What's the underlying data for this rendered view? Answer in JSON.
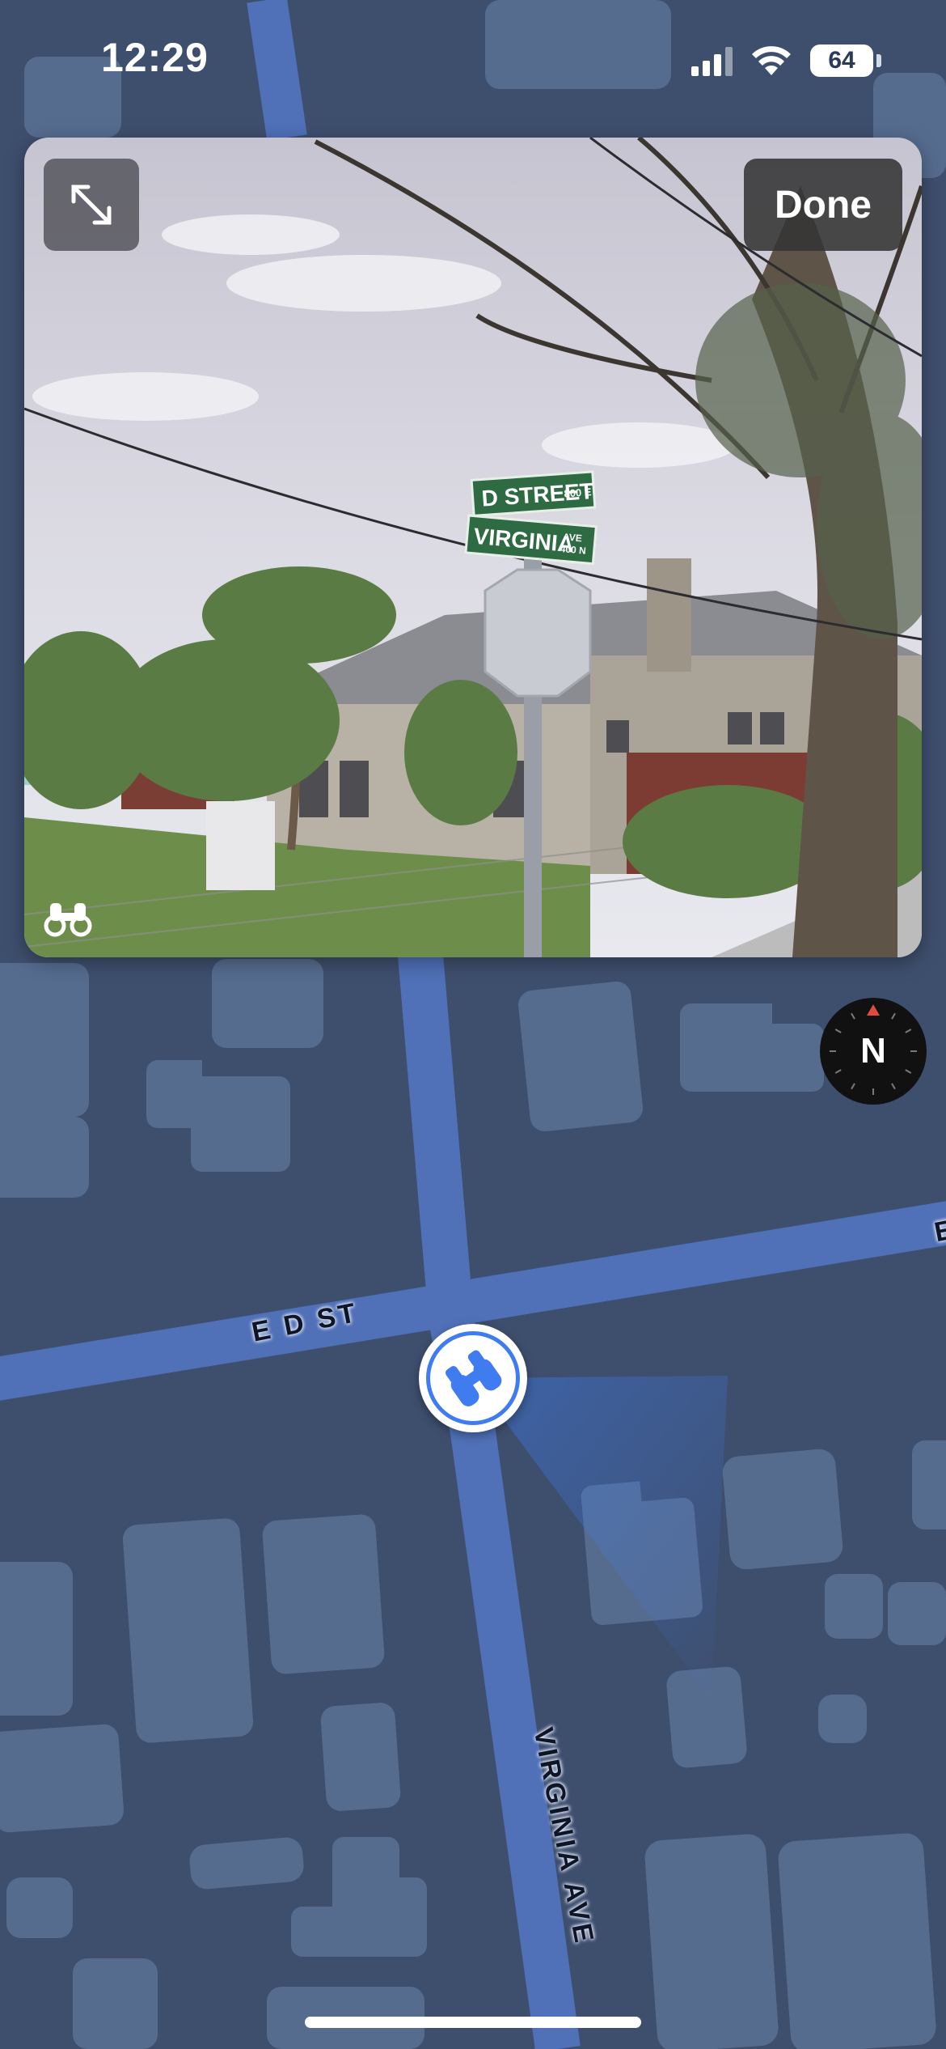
{
  "status_bar": {
    "time": "12:29",
    "battery_level": "64",
    "battery_fraction": 0.64
  },
  "look_around": {
    "done_label": "Done",
    "sign_street_1": "D STREET",
    "sign_block_1": "800 E",
    "sign_street_2": "VIRGINIA",
    "sign_block_2a": "AVE",
    "sign_block_2b": "400 N",
    "icons": {
      "expand": "expand-arrows-icon",
      "badge": "binoculars-icon"
    }
  },
  "map": {
    "streets": {
      "d_st": "E D ST",
      "virginia": "VIRGINIA AVE",
      "edge": "E"
    },
    "compass_letter": "N",
    "colors": {
      "background": "#3e4f6e",
      "road": "#5070b8",
      "building": "#566c8f",
      "pin_accent": "#3f7cf0",
      "compass_needle": "#e04a3f"
    }
  }
}
